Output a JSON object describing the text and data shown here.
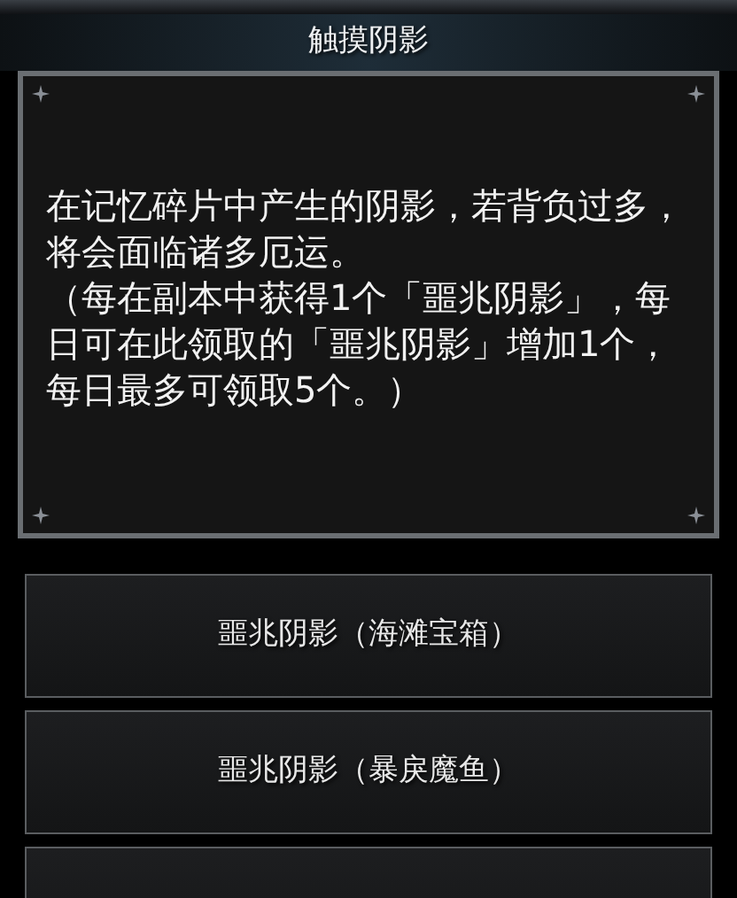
{
  "title": "触摸阴影",
  "description": [
    "在记忆碎片中产生的阴影，若背负过多，将会面临诸多厄运。",
    "（每在副本中获得1个「噩兆阴影」，每日可在此领取的「噩兆阴影」增加1个，每日最多可领取5个。）"
  ],
  "options": [
    {
      "kind": "option",
      "label": "噩兆阴影（海滩宝箱）"
    },
    {
      "kind": "option",
      "label": "噩兆阴影（暴戾魔鱼）"
    },
    {
      "kind": "cut"
    }
  ]
}
